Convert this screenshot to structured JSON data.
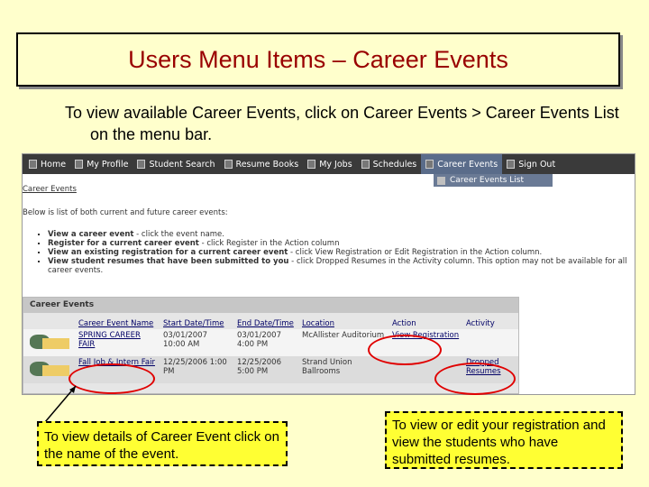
{
  "title": "Users Menu Items – Career Events",
  "intro": "To view available Career Events, click on Career Events > Career Events List on the menu bar.",
  "menu": {
    "items": [
      "Home",
      "My Profile",
      "Student Search",
      "Resume Books",
      "My Jobs",
      "Schedules",
      "Career Events",
      "Sign Out"
    ],
    "submenu": "Career Events List"
  },
  "breadcrumb": "Career Events",
  "description": "Below is list of both current and future career events:",
  "bullets": [
    {
      "bold": "View a career event",
      "rest": " - click the event name."
    },
    {
      "bold": "Register for a current career event",
      "rest": " - click Register in the Action column"
    },
    {
      "bold": "View an existing registration for a current career event",
      "rest": " - click View Registration or Edit Registration in the Action column."
    },
    {
      "bold": "View student resumes that have been submitted to you",
      "rest": " - click Dropped Resumes in the Activity column. This option may not be available for all career events."
    }
  ],
  "events": {
    "header": "Career Events",
    "columns": [
      "Career Event Name",
      "Start Date/Time",
      "End Date/Time",
      "Location",
      "Action",
      "Activity"
    ],
    "rows": [
      {
        "name": "SPRING CAREER FAIR",
        "start": "03/01/2007 10:00 AM",
        "end": "03/01/2007 4:00 PM",
        "location": "McAllister Auditorium",
        "action": "View Registration",
        "activity": ""
      },
      {
        "name": "Fall Job & Intern Fair",
        "start": "12/25/2006 1:00 PM",
        "end": "12/25/2006 5:00 PM",
        "location": "Strand Union Ballrooms",
        "action": "",
        "activity": "Dropped Resumes"
      }
    ]
  },
  "callouts": {
    "left": "To view details of Career Event click on the name of the event.",
    "right": "To view or edit your registration and view the students who have submitted resumes."
  },
  "colors": {
    "title": "#990000",
    "background": "#ffffcc",
    "callout": "#ffff33",
    "highlight": "#e00000"
  }
}
